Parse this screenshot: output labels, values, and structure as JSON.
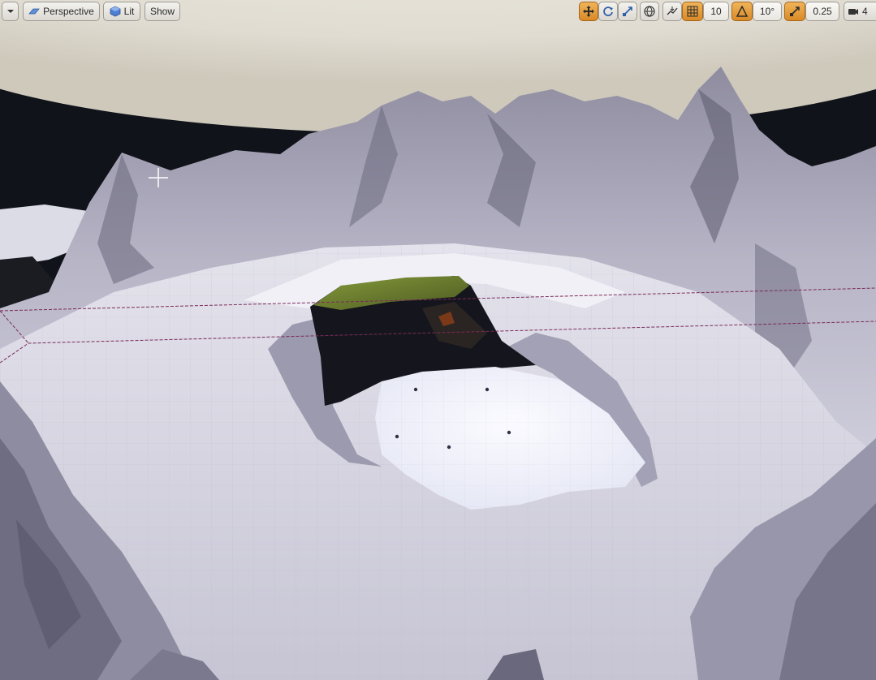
{
  "toolbar": {
    "menu_icon": "chevron-down-icon",
    "view_mode": "Perspective",
    "lit_mode": "Lit",
    "show_label": "Show",
    "grid_snap_value": "10",
    "rotation_snap_value": "10°",
    "scale_snap_value": "0.25",
    "camera_speed_value": "4"
  },
  "colors": {
    "active_tool": "#e39a3a",
    "snow": "#dedde8",
    "rock_dark": "#3a3948",
    "grass": "#6a7a30",
    "sky_dome": "#e6e2d6"
  }
}
